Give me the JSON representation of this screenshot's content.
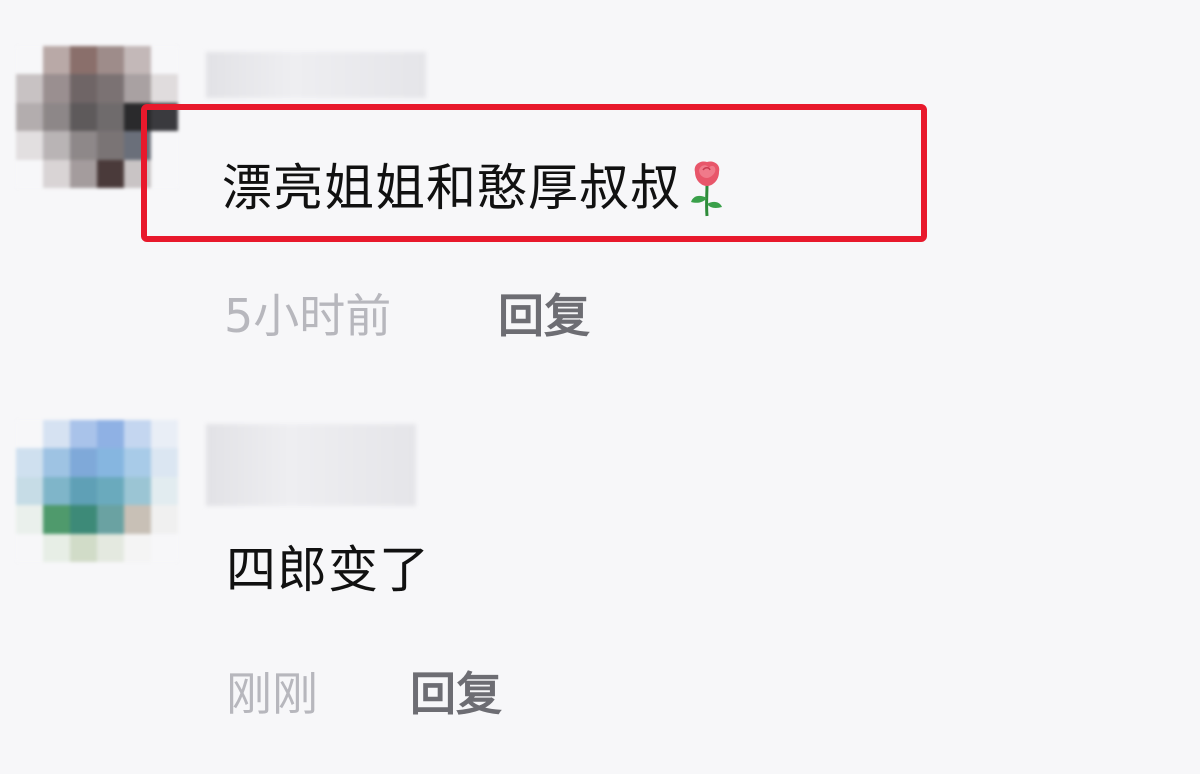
{
  "comments": [
    {
      "text": "漂亮姐姐和憨厚叔叔",
      "emoji": "rose-emoji",
      "time": "5小时前",
      "reply_label": "回复",
      "highlighted": true,
      "highlight_color": "#e8192c"
    },
    {
      "text": "四郎变了",
      "time": "刚刚",
      "reply_label": "回复",
      "highlighted": false
    }
  ],
  "colors": {
    "background": "#f7f7f9",
    "time_text": "#b7b7bd",
    "reply_text": "#6d6d73",
    "comment_text": "#111111"
  }
}
